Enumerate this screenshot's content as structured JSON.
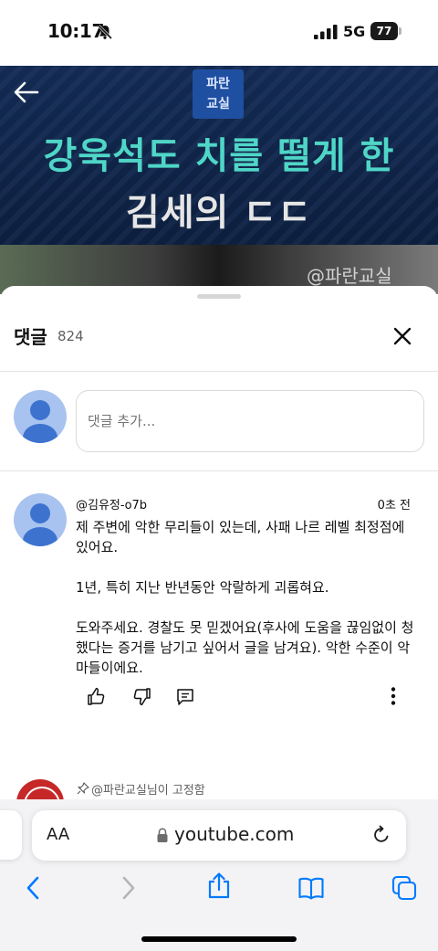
{
  "status_bar": {
    "time": "10:17",
    "network": "5G",
    "battery": "77"
  },
  "video": {
    "badge_line1": "파란",
    "badge_line2": "교실",
    "title_line1": "강욱석도 치를 떨게 한",
    "title_line2": "김세의 ㄷㄷ",
    "watermark": "@파란교실"
  },
  "comments_panel": {
    "title": "댓글",
    "count": "824",
    "input_placeholder": "댓글 추가..."
  },
  "comment": {
    "author": "@김유정-o7b",
    "time": "0초 전",
    "paragraph1": "제 주변에 악한 무리들이 있는데, 사패 나르 레벨 최정점에 있어요.",
    "paragraph2": "1년, 특히 지난 반년동안 악랄하게 괴롭혀요.",
    "paragraph3": "도와주세요.  경찰도 못 믿겠어요(후사에 도움을 끊임없이 청했다는 증거를 남기고 싶어서 글을 남겨요).  악한 수준이 악마들이에요."
  },
  "pinned": {
    "label": "@파란교실님이 고정함"
  },
  "safari": {
    "text_size_label": "AA",
    "url": "youtube.com"
  },
  "colors": {
    "accent_teal": "#4fd6c7",
    "avatar_bg": "#a8c3ef",
    "avatar_fg": "#3d73cf",
    "ios_blue": "#007aff"
  }
}
